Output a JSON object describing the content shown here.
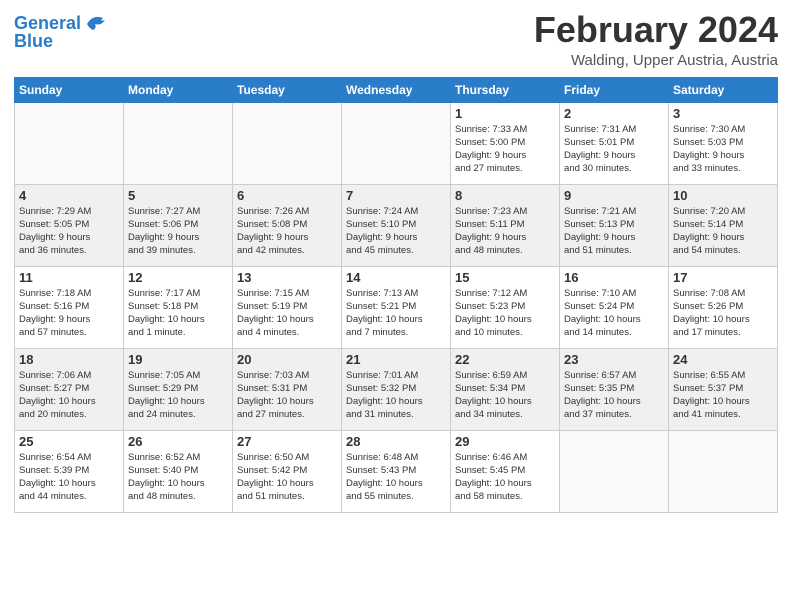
{
  "logo": {
    "line1": "General",
    "line2": "Blue"
  },
  "title": "February 2024",
  "location": "Walding, Upper Austria, Austria",
  "days_of_week": [
    "Sunday",
    "Monday",
    "Tuesday",
    "Wednesday",
    "Thursday",
    "Friday",
    "Saturday"
  ],
  "weeks": [
    [
      {
        "day": "",
        "info": ""
      },
      {
        "day": "",
        "info": ""
      },
      {
        "day": "",
        "info": ""
      },
      {
        "day": "",
        "info": ""
      },
      {
        "day": "1",
        "info": "Sunrise: 7:33 AM\nSunset: 5:00 PM\nDaylight: 9 hours\nand 27 minutes."
      },
      {
        "day": "2",
        "info": "Sunrise: 7:31 AM\nSunset: 5:01 PM\nDaylight: 9 hours\nand 30 minutes."
      },
      {
        "day": "3",
        "info": "Sunrise: 7:30 AM\nSunset: 5:03 PM\nDaylight: 9 hours\nand 33 minutes."
      }
    ],
    [
      {
        "day": "4",
        "info": "Sunrise: 7:29 AM\nSunset: 5:05 PM\nDaylight: 9 hours\nand 36 minutes."
      },
      {
        "day": "5",
        "info": "Sunrise: 7:27 AM\nSunset: 5:06 PM\nDaylight: 9 hours\nand 39 minutes."
      },
      {
        "day": "6",
        "info": "Sunrise: 7:26 AM\nSunset: 5:08 PM\nDaylight: 9 hours\nand 42 minutes."
      },
      {
        "day": "7",
        "info": "Sunrise: 7:24 AM\nSunset: 5:10 PM\nDaylight: 9 hours\nand 45 minutes."
      },
      {
        "day": "8",
        "info": "Sunrise: 7:23 AM\nSunset: 5:11 PM\nDaylight: 9 hours\nand 48 minutes."
      },
      {
        "day": "9",
        "info": "Sunrise: 7:21 AM\nSunset: 5:13 PM\nDaylight: 9 hours\nand 51 minutes."
      },
      {
        "day": "10",
        "info": "Sunrise: 7:20 AM\nSunset: 5:14 PM\nDaylight: 9 hours\nand 54 minutes."
      }
    ],
    [
      {
        "day": "11",
        "info": "Sunrise: 7:18 AM\nSunset: 5:16 PM\nDaylight: 9 hours\nand 57 minutes."
      },
      {
        "day": "12",
        "info": "Sunrise: 7:17 AM\nSunset: 5:18 PM\nDaylight: 10 hours\nand 1 minute."
      },
      {
        "day": "13",
        "info": "Sunrise: 7:15 AM\nSunset: 5:19 PM\nDaylight: 10 hours\nand 4 minutes."
      },
      {
        "day": "14",
        "info": "Sunrise: 7:13 AM\nSunset: 5:21 PM\nDaylight: 10 hours\nand 7 minutes."
      },
      {
        "day": "15",
        "info": "Sunrise: 7:12 AM\nSunset: 5:23 PM\nDaylight: 10 hours\nand 10 minutes."
      },
      {
        "day": "16",
        "info": "Sunrise: 7:10 AM\nSunset: 5:24 PM\nDaylight: 10 hours\nand 14 minutes."
      },
      {
        "day": "17",
        "info": "Sunrise: 7:08 AM\nSunset: 5:26 PM\nDaylight: 10 hours\nand 17 minutes."
      }
    ],
    [
      {
        "day": "18",
        "info": "Sunrise: 7:06 AM\nSunset: 5:27 PM\nDaylight: 10 hours\nand 20 minutes."
      },
      {
        "day": "19",
        "info": "Sunrise: 7:05 AM\nSunset: 5:29 PM\nDaylight: 10 hours\nand 24 minutes."
      },
      {
        "day": "20",
        "info": "Sunrise: 7:03 AM\nSunset: 5:31 PM\nDaylight: 10 hours\nand 27 minutes."
      },
      {
        "day": "21",
        "info": "Sunrise: 7:01 AM\nSunset: 5:32 PM\nDaylight: 10 hours\nand 31 minutes."
      },
      {
        "day": "22",
        "info": "Sunrise: 6:59 AM\nSunset: 5:34 PM\nDaylight: 10 hours\nand 34 minutes."
      },
      {
        "day": "23",
        "info": "Sunrise: 6:57 AM\nSunset: 5:35 PM\nDaylight: 10 hours\nand 37 minutes."
      },
      {
        "day": "24",
        "info": "Sunrise: 6:55 AM\nSunset: 5:37 PM\nDaylight: 10 hours\nand 41 minutes."
      }
    ],
    [
      {
        "day": "25",
        "info": "Sunrise: 6:54 AM\nSunset: 5:39 PM\nDaylight: 10 hours\nand 44 minutes."
      },
      {
        "day": "26",
        "info": "Sunrise: 6:52 AM\nSunset: 5:40 PM\nDaylight: 10 hours\nand 48 minutes."
      },
      {
        "day": "27",
        "info": "Sunrise: 6:50 AM\nSunset: 5:42 PM\nDaylight: 10 hours\nand 51 minutes."
      },
      {
        "day": "28",
        "info": "Sunrise: 6:48 AM\nSunset: 5:43 PM\nDaylight: 10 hours\nand 55 minutes."
      },
      {
        "day": "29",
        "info": "Sunrise: 6:46 AM\nSunset: 5:45 PM\nDaylight: 10 hours\nand 58 minutes."
      },
      {
        "day": "",
        "info": ""
      },
      {
        "day": "",
        "info": ""
      }
    ]
  ]
}
